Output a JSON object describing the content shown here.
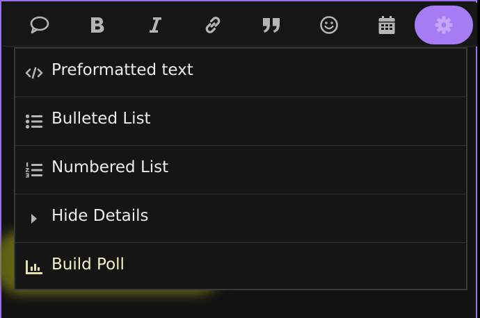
{
  "colors": {
    "accent": "#a67cf4",
    "frame": "#9b6cf0",
    "background": "#131313",
    "icon": "#b5b5b5",
    "text": "#ececec",
    "highlight": "#78781a"
  },
  "toolbar": {
    "buttons": [
      {
        "icon": "speech-bubble-icon",
        "active": false
      },
      {
        "icon": "bold-icon",
        "active": false
      },
      {
        "icon": "italic-icon",
        "active": false
      },
      {
        "icon": "link-icon",
        "active": false
      },
      {
        "icon": "quote-icon",
        "active": false
      },
      {
        "icon": "emoji-icon",
        "active": false
      },
      {
        "icon": "calendar-icon",
        "active": false
      },
      {
        "icon": "gear-icon",
        "active": true
      }
    ]
  },
  "menu": {
    "items": [
      {
        "label": "Preformatted text",
        "icon": "code-icon"
      },
      {
        "label": "Bulleted List",
        "icon": "bulleted-list-icon"
      },
      {
        "label": "Numbered List",
        "icon": "numbered-list-icon"
      },
      {
        "label": "Hide Details",
        "icon": "caret-right-icon"
      },
      {
        "label": "Build Poll",
        "icon": "bar-chart-icon",
        "highlighted": true
      }
    ]
  }
}
